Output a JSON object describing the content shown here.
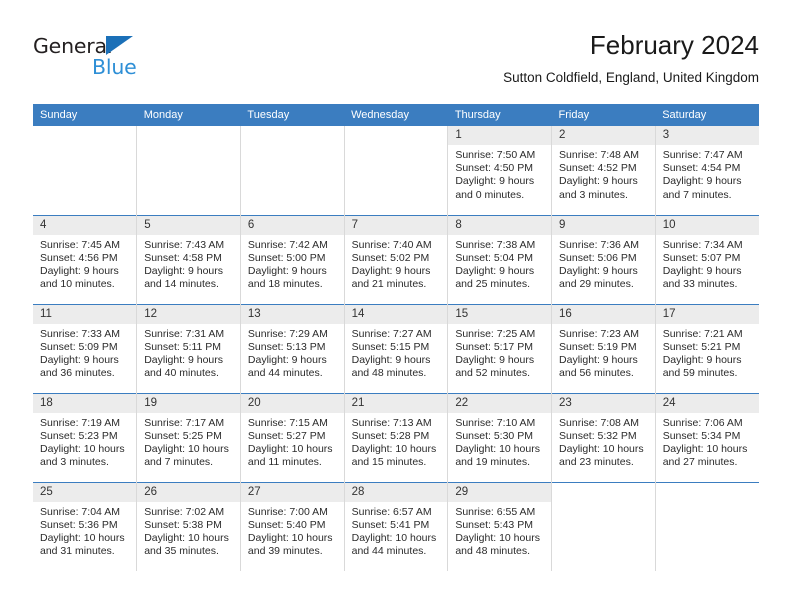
{
  "logo": {
    "word1": "General",
    "word2": "Blue",
    "triangle_color": "#1b70b8",
    "word2_color": "#2e8fd6"
  },
  "header": {
    "title": "February 2024",
    "subtitle": "Sutton Coldfield, England, United Kingdom"
  },
  "theme": {
    "header_blue": "#3b7dc0",
    "daynum_band": "#ececec",
    "cell_border": "#d9d9d9",
    "text": "#2b2b2b"
  },
  "weekday_headers": [
    "Sunday",
    "Monday",
    "Tuesday",
    "Wednesday",
    "Thursday",
    "Friday",
    "Saturday"
  ],
  "weeks": [
    [
      {
        "day": "",
        "blank": true
      },
      {
        "day": "",
        "blank": true
      },
      {
        "day": "",
        "blank": true
      },
      {
        "day": "",
        "blank": true
      },
      {
        "day": "1",
        "sunrise": "Sunrise: 7:50 AM",
        "sunset": "Sunset: 4:50 PM",
        "daylight1": "Daylight: 9 hours",
        "daylight2": "and 0 minutes."
      },
      {
        "day": "2",
        "sunrise": "Sunrise: 7:48 AM",
        "sunset": "Sunset: 4:52 PM",
        "daylight1": "Daylight: 9 hours",
        "daylight2": "and 3 minutes."
      },
      {
        "day": "3",
        "sunrise": "Sunrise: 7:47 AM",
        "sunset": "Sunset: 4:54 PM",
        "daylight1": "Daylight: 9 hours",
        "daylight2": "and 7 minutes."
      }
    ],
    [
      {
        "day": "4",
        "sunrise": "Sunrise: 7:45 AM",
        "sunset": "Sunset: 4:56 PM",
        "daylight1": "Daylight: 9 hours",
        "daylight2": "and 10 minutes."
      },
      {
        "day": "5",
        "sunrise": "Sunrise: 7:43 AM",
        "sunset": "Sunset: 4:58 PM",
        "daylight1": "Daylight: 9 hours",
        "daylight2": "and 14 minutes."
      },
      {
        "day": "6",
        "sunrise": "Sunrise: 7:42 AM",
        "sunset": "Sunset: 5:00 PM",
        "daylight1": "Daylight: 9 hours",
        "daylight2": "and 18 minutes."
      },
      {
        "day": "7",
        "sunrise": "Sunrise: 7:40 AM",
        "sunset": "Sunset: 5:02 PM",
        "daylight1": "Daylight: 9 hours",
        "daylight2": "and 21 minutes."
      },
      {
        "day": "8",
        "sunrise": "Sunrise: 7:38 AM",
        "sunset": "Sunset: 5:04 PM",
        "daylight1": "Daylight: 9 hours",
        "daylight2": "and 25 minutes."
      },
      {
        "day": "9",
        "sunrise": "Sunrise: 7:36 AM",
        "sunset": "Sunset: 5:06 PM",
        "daylight1": "Daylight: 9 hours",
        "daylight2": "and 29 minutes."
      },
      {
        "day": "10",
        "sunrise": "Sunrise: 7:34 AM",
        "sunset": "Sunset: 5:07 PM",
        "daylight1": "Daylight: 9 hours",
        "daylight2": "and 33 minutes."
      }
    ],
    [
      {
        "day": "11",
        "sunrise": "Sunrise: 7:33 AM",
        "sunset": "Sunset: 5:09 PM",
        "daylight1": "Daylight: 9 hours",
        "daylight2": "and 36 minutes."
      },
      {
        "day": "12",
        "sunrise": "Sunrise: 7:31 AM",
        "sunset": "Sunset: 5:11 PM",
        "daylight1": "Daylight: 9 hours",
        "daylight2": "and 40 minutes."
      },
      {
        "day": "13",
        "sunrise": "Sunrise: 7:29 AM",
        "sunset": "Sunset: 5:13 PM",
        "daylight1": "Daylight: 9 hours",
        "daylight2": "and 44 minutes."
      },
      {
        "day": "14",
        "sunrise": "Sunrise: 7:27 AM",
        "sunset": "Sunset: 5:15 PM",
        "daylight1": "Daylight: 9 hours",
        "daylight2": "and 48 minutes."
      },
      {
        "day": "15",
        "sunrise": "Sunrise: 7:25 AM",
        "sunset": "Sunset: 5:17 PM",
        "daylight1": "Daylight: 9 hours",
        "daylight2": "and 52 minutes."
      },
      {
        "day": "16",
        "sunrise": "Sunrise: 7:23 AM",
        "sunset": "Sunset: 5:19 PM",
        "daylight1": "Daylight: 9 hours",
        "daylight2": "and 56 minutes."
      },
      {
        "day": "17",
        "sunrise": "Sunrise: 7:21 AM",
        "sunset": "Sunset: 5:21 PM",
        "daylight1": "Daylight: 9 hours",
        "daylight2": "and 59 minutes."
      }
    ],
    [
      {
        "day": "18",
        "sunrise": "Sunrise: 7:19 AM",
        "sunset": "Sunset: 5:23 PM",
        "daylight1": "Daylight: 10 hours",
        "daylight2": "and 3 minutes."
      },
      {
        "day": "19",
        "sunrise": "Sunrise: 7:17 AM",
        "sunset": "Sunset: 5:25 PM",
        "daylight1": "Daylight: 10 hours",
        "daylight2": "and 7 minutes."
      },
      {
        "day": "20",
        "sunrise": "Sunrise: 7:15 AM",
        "sunset": "Sunset: 5:27 PM",
        "daylight1": "Daylight: 10 hours",
        "daylight2": "and 11 minutes."
      },
      {
        "day": "21",
        "sunrise": "Sunrise: 7:13 AM",
        "sunset": "Sunset: 5:28 PM",
        "daylight1": "Daylight: 10 hours",
        "daylight2": "and 15 minutes."
      },
      {
        "day": "22",
        "sunrise": "Sunrise: 7:10 AM",
        "sunset": "Sunset: 5:30 PM",
        "daylight1": "Daylight: 10 hours",
        "daylight2": "and 19 minutes."
      },
      {
        "day": "23",
        "sunrise": "Sunrise: 7:08 AM",
        "sunset": "Sunset: 5:32 PM",
        "daylight1": "Daylight: 10 hours",
        "daylight2": "and 23 minutes."
      },
      {
        "day": "24",
        "sunrise": "Sunrise: 7:06 AM",
        "sunset": "Sunset: 5:34 PM",
        "daylight1": "Daylight: 10 hours",
        "daylight2": "and 27 minutes."
      }
    ],
    [
      {
        "day": "25",
        "sunrise": "Sunrise: 7:04 AM",
        "sunset": "Sunset: 5:36 PM",
        "daylight1": "Daylight: 10 hours",
        "daylight2": "and 31 minutes."
      },
      {
        "day": "26",
        "sunrise": "Sunrise: 7:02 AM",
        "sunset": "Sunset: 5:38 PM",
        "daylight1": "Daylight: 10 hours",
        "daylight2": "and 35 minutes."
      },
      {
        "day": "27",
        "sunrise": "Sunrise: 7:00 AM",
        "sunset": "Sunset: 5:40 PM",
        "daylight1": "Daylight: 10 hours",
        "daylight2": "and 39 minutes."
      },
      {
        "day": "28",
        "sunrise": "Sunrise: 6:57 AM",
        "sunset": "Sunset: 5:41 PM",
        "daylight1": "Daylight: 10 hours",
        "daylight2": "and 44 minutes."
      },
      {
        "day": "29",
        "sunrise": "Sunrise: 6:55 AM",
        "sunset": "Sunset: 5:43 PM",
        "daylight1": "Daylight: 10 hours",
        "daylight2": "and 48 minutes."
      },
      {
        "day": "",
        "blank": true
      },
      {
        "day": "",
        "blank": true
      }
    ]
  ]
}
